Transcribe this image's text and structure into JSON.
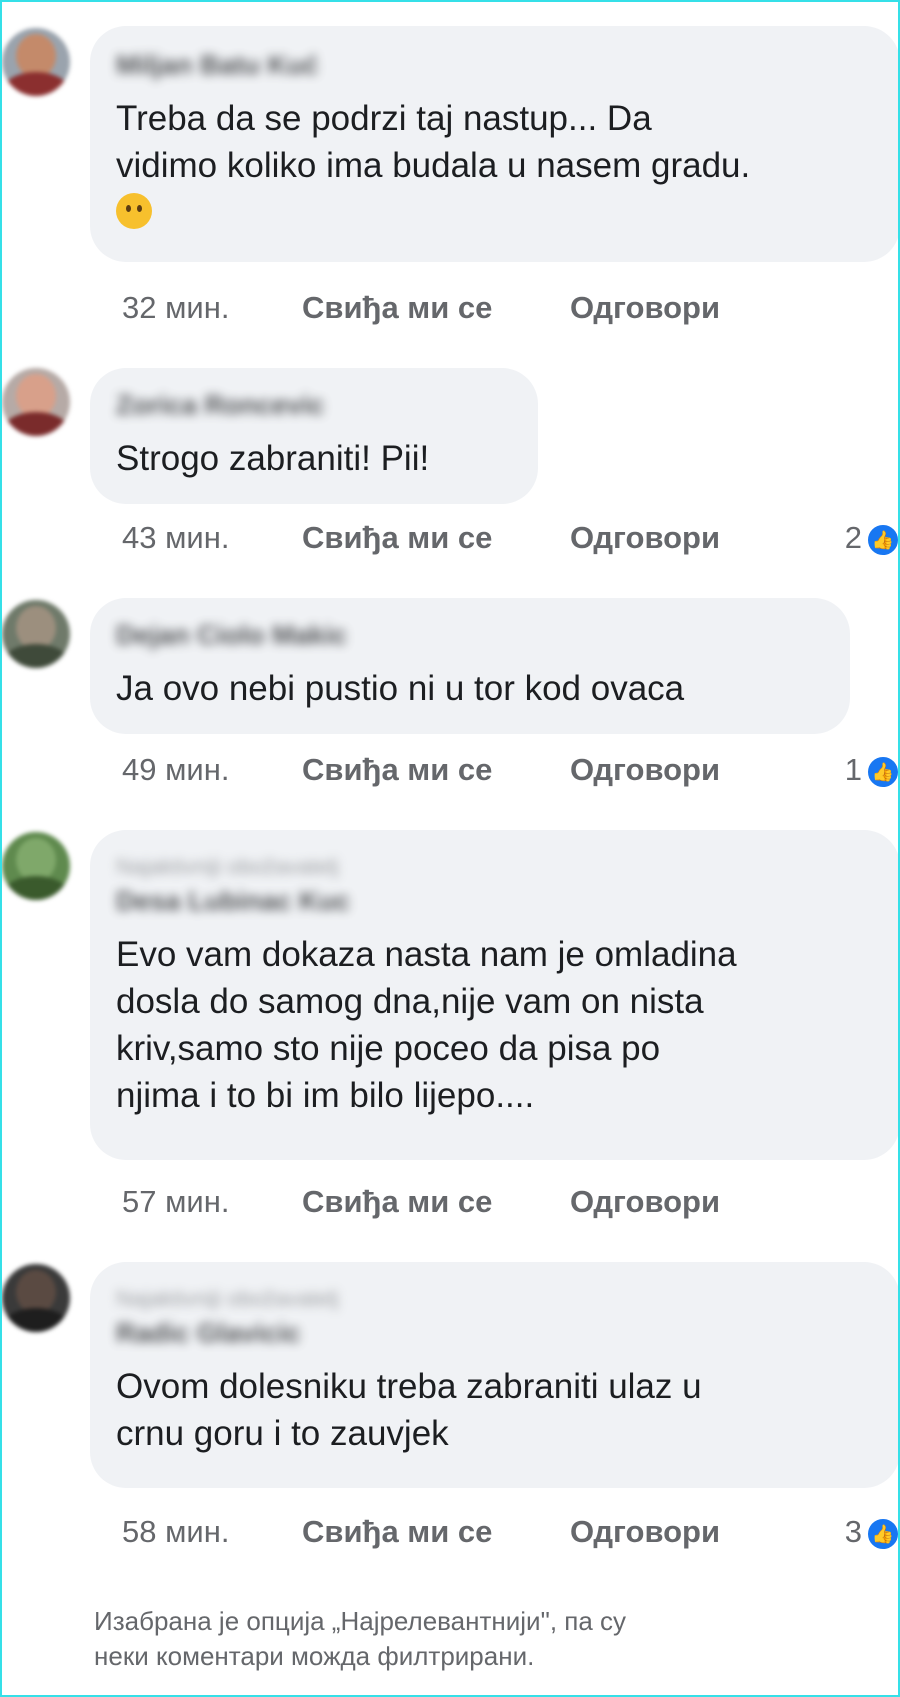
{
  "comments": [
    {
      "author": "Miljan Batu Kuć",
      "pre": "",
      "text": "Treba da se podrzi taj nastup... Da\nvidimo koliko ima budala u nasem gradu.",
      "emoji": "thinking-face",
      "time": "32 мин.",
      "like": "Свиђа ми се",
      "reply": "Одговори",
      "reactions": ""
    },
    {
      "author": "Zorica Roncevic",
      "pre": "",
      "text": "Strogo zabraniti! Pii!",
      "emoji": "",
      "time": "43 мин.",
      "like": "Свиђа ми се",
      "reply": "Одговори",
      "reactions": "2"
    },
    {
      "author": "Dejan Ciolo Makic",
      "pre": "",
      "text": "Ja ovo nebi pustio ni u tor kod ovaca",
      "emoji": "",
      "time": "49 мин.",
      "like": "Свиђа ми се",
      "reply": "Одговори",
      "reactions": "1"
    },
    {
      "author": "Desa Lubinac Kuc",
      "pre": "Najaktivniji obožavatelj",
      "text": "Evo vam dokaza nasta nam je omladina\ndosla do samog dna,nije vam on nista\nkriv,samo sto nije poceo da pisa po\nnjima i to bi im bilo lijepo....",
      "emoji": "",
      "time": "57 мин.",
      "like": "Свиђа ми се",
      "reply": "Одговори",
      "reactions": ""
    },
    {
      "author": "Radic Glavicic",
      "pre": "Najaktivniji obožavatelj",
      "text": "Ovom dolesniku treba zabraniti ulaz u\ncrnu goru i to zauvjek",
      "emoji": "",
      "time": "58 мин.",
      "like": "Свиђа ми се",
      "reply": "Одговори",
      "reactions": "3"
    }
  ],
  "footer": "Изабрана је опција „Најрелевантнији\", па су\nнеки коментари можда филтрирани.",
  "colors": {
    "bubble": "#f0f2f5",
    "meta_text": "#65676b",
    "body_text": "#1c1e21",
    "like_blue": "#1877f2",
    "frame": "#35e0e8"
  }
}
